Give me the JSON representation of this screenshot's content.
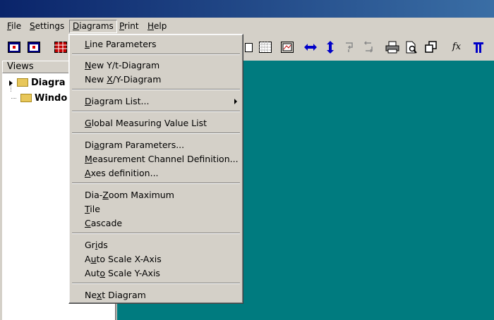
{
  "menubar": {
    "items": [
      {
        "pre": "",
        "key": "F",
        "post": "ile"
      },
      {
        "pre": "",
        "key": "S",
        "post": "ettings"
      },
      {
        "pre": "",
        "key": "D",
        "post": "iagrams"
      },
      {
        "pre": "",
        "key": "P",
        "post": "rint"
      },
      {
        "pre": "",
        "key": "H",
        "post": "elp"
      }
    ]
  },
  "views": {
    "title": "Views",
    "tree": [
      "Diagra",
      "Windo"
    ]
  },
  "diagrams_menu": {
    "items": [
      {
        "pre": "",
        "key": "L",
        "post": "ine Parameters"
      },
      {
        "pre": "",
        "key": "N",
        "post": "ew Y/t-Diagram"
      },
      {
        "pre": "New ",
        "key": "X",
        "post": "/Y-Diagram"
      },
      {
        "pre": "",
        "key": "D",
        "post": "iagram List..."
      },
      {
        "pre": "",
        "key": "G",
        "post": "lobal Measuring Value List"
      },
      {
        "pre": "Di",
        "key": "a",
        "post": "gram Parameters..."
      },
      {
        "pre": "",
        "key": "M",
        "post": "easurement Channel Definition..."
      },
      {
        "pre": "",
        "key": "A",
        "post": "xes definition..."
      },
      {
        "pre": "Dia-",
        "key": "Z",
        "post": "oom Maximum"
      },
      {
        "pre": "",
        "key": "T",
        "post": "ile"
      },
      {
        "pre": "",
        "key": "C",
        "post": "ascade"
      },
      {
        "pre": "Gr",
        "key": "i",
        "post": "ds"
      },
      {
        "pre": "A",
        "key": "u",
        "post": "to Scale X-Axis"
      },
      {
        "pre": "Aut",
        "key": "o",
        "post": " Scale Y-Axis"
      },
      {
        "pre": "Ne",
        "key": "x",
        "post": "t Diagram"
      }
    ]
  },
  "toolbar": {
    "fx_label": "fx"
  }
}
